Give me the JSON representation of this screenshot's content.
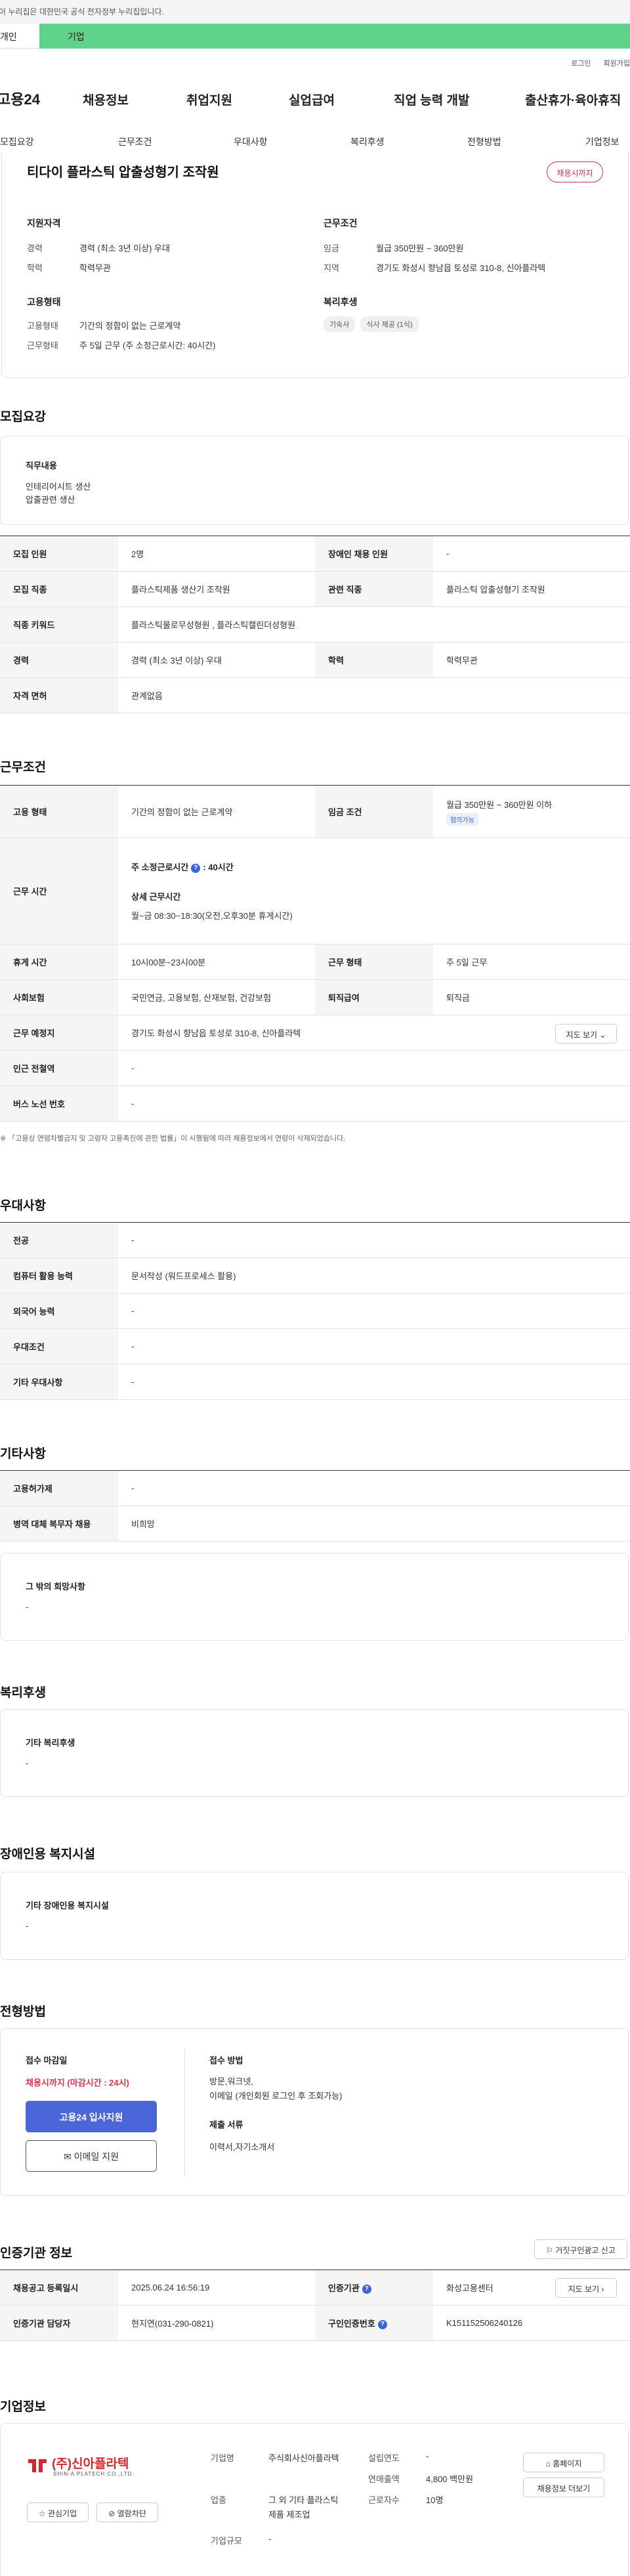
{
  "gov_banner": "이 누리집은 대한민국 공식 전자정부 누리집입니다.",
  "tabs": [
    "개인",
    "기업"
  ],
  "top_links": [
    "로그인",
    "회원가입"
  ],
  "logo": "고용24",
  "main_nav": [
    "채용정보",
    "취업지원",
    "실업급여",
    "직업 능력 개발",
    "출산휴가·육아휴직"
  ],
  "sub_nav": [
    "모집요강",
    "근무조건",
    "우대사항",
    "복리후생",
    "전형방법",
    "기업정보"
  ],
  "summary": {
    "title": "티다이 플라스틱 압출성형기 조작원",
    "badge": "채용시까지",
    "qual_heading": "지원자격",
    "career_label": "경력",
    "career_value": "경력 (최소 3년 이상) 우대",
    "edu_label": "학력",
    "edu_value": "학력무관",
    "emp_heading": "고용형태",
    "emptype_label": "고용형태",
    "emptype_value": "기간의 정함이 없는 근로계약",
    "worktype_label": "근무형태",
    "worktype_value": "주 5일 근무 (주 소정근로시간: 40시간)",
    "cond_heading": "근무조건",
    "wage_label": "임금",
    "wage_value": "월급 350만원 ~ 360만원",
    "region_label": "지역",
    "region_value": "경기도 화성시 향남읍 토성로 310-8, 신아플라텍",
    "welfare_heading": "복리후생",
    "welfare_chips": [
      "기숙사",
      "식사 제공 (1식)"
    ]
  },
  "recruit": {
    "heading": "모집요강",
    "job_desc_label": "직무내용",
    "job_desc_lines": [
      "인테리어시트 생산",
      "압출관련 생산"
    ],
    "rows": [
      [
        "모집 인원",
        "2명",
        "장애인 채용 인원",
        "-"
      ],
      [
        "모집 직종",
        "플라스틱제품 생산기 조작원",
        "관련 직종",
        "플라스틱 압출성형기 조작원"
      ],
      [
        "직종 키워드",
        "플라스틱물로무성형원 , 플라스틱캘린더성형원",
        "",
        ""
      ],
      [
        "경력",
        "경력 (최소 3년 이상) 우대",
        "학력",
        "학력무관"
      ],
      [
        "자격 면허",
        "관계없음",
        "",
        ""
      ]
    ]
  },
  "conditions": {
    "heading": "근무조건",
    "emp_label": "고용 형태",
    "emp_value": "기간의 정함이 없는 근로계약",
    "wage_label": "임금 조건",
    "wage_value": "월급 350만원 ~ 360만원 이하",
    "wage_tag": "협의가능",
    "hours_label": "근무 시간",
    "hours_weekly_label": "주 소정근로시간",
    "hours_weekly_value": ": 40시간",
    "hours_detail_label": "상세 근무시간",
    "hours_detail_value": "월~금  08:30~18:30(오전,오후30분 휴게시간)",
    "rest_label": "휴게 시간",
    "rest_value": "10시00분~23시00분",
    "form_label": "근무 형태",
    "form_value": "주 5일 근무",
    "ins_label": "사회보험",
    "ins_value": "국민연금, 고용보험, 산재보험, 건강보험",
    "sev_label": "퇴직급여",
    "sev_value": "퇴직금",
    "place_label": "근무 예정지",
    "place_value": "경기도 화성시 향남읍 토성로 310-8, 신아플라텍",
    "map_btn": "지도 보기",
    "station_label": "인근 전철역",
    "station_value": "-",
    "bus_label": "버스 노선 번호",
    "bus_value": "-",
    "note": "※ 「고용상 연령차별금지 및 고령자 고용촉진에 관한 법률」이 시행됨에 따라 채용정보에서 연령이 삭제되었습니다."
  },
  "preferred": {
    "heading": "우대사항",
    "rows": [
      [
        "전공",
        "-"
      ],
      [
        "컴퓨터 활용 능력",
        "문서작성 (워드프로세스 활용)"
      ],
      [
        "외국어 능력",
        "-"
      ],
      [
        "우대조건",
        "-"
      ],
      [
        "기타 우대사항",
        "-"
      ]
    ]
  },
  "etc": {
    "heading": "기타사항",
    "rows": [
      [
        "고용허가제",
        "-"
      ],
      [
        "병역 대체 복무자 채용",
        "비희망"
      ]
    ],
    "other_label": "그 밖의 희망사항",
    "other_value": "-"
  },
  "welfare": {
    "heading": "복리후생",
    "label": "기타 복리후생",
    "value": "-"
  },
  "disability": {
    "heading": "장애인용 복지시설",
    "label": "기타 장애인용 복지시설",
    "value": "-"
  },
  "selection": {
    "heading": "전형방법",
    "deadline_label": "접수 마감일",
    "deadline_value": "채용시까지 (마감시간 : 24시)",
    "apply_btn": "고용24 입사지원",
    "email_btn": "이메일 지원",
    "method_label": "접수 방법",
    "method_lines": [
      "방문,워크넷,",
      "이메일 (개인회원 로그인 후 조회가능)"
    ],
    "docs_label": "제출 서류",
    "docs_value": "이력서,자기소개서"
  },
  "agency": {
    "heading": "인증기관 정보",
    "report_btn": "거짓구인광고 신고",
    "rows": [
      [
        "채용공고 등록일시",
        "2025.06.24 16:56:19",
        "인증기관",
        "화성고용센터"
      ],
      [
        "인증기관 담당자",
        "현지연(031-290-0821)",
        "구인인증번호",
        "K151152506240126"
      ]
    ],
    "map_btn": "지도 보기"
  },
  "company": {
    "heading": "기업정보",
    "logo_text": "(주)신아플라텍",
    "logo_sub": "SHIN-A PLATECH CO.,LTD.",
    "interest_btn": "관심기업",
    "block_btn": "열람차단",
    "name_label": "기업명",
    "name_value": "주식회사신아플라텍",
    "industry_label": "업종",
    "industry_value": "그 외 기타 플라스틱 제품 제조업",
    "size_label": "기업규모",
    "size_value": "-",
    "founded_label": "설립연도",
    "founded_value": "-",
    "sales_label": "연매출액",
    "sales_value": "4,800 백만원",
    "employees_label": "근로자수",
    "employees_value": "10명",
    "homepage_btn": "홈페이지",
    "more_btn": "채용정보 더보기"
  }
}
